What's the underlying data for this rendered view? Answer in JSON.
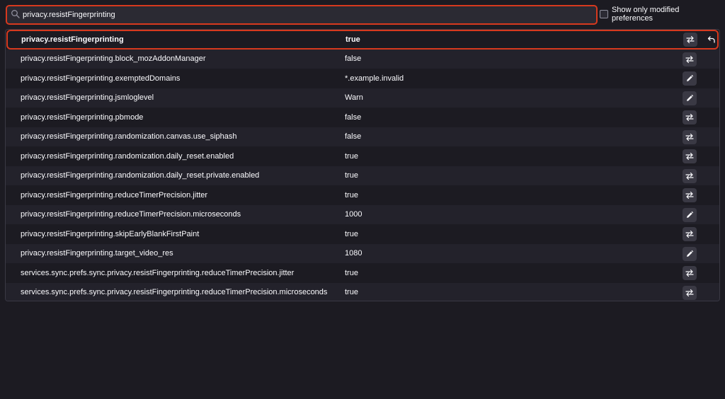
{
  "search": {
    "value": "privacy.resistFingerprinting",
    "placeholder": ""
  },
  "modified_only": {
    "label": "Show only modified preferences",
    "checked": false
  },
  "colors": {
    "background": "#1c1b22",
    "row_alt": "#23222b",
    "highlight": "#d7391e",
    "button": "#3a3944"
  },
  "prefs": [
    {
      "name": "privacy.resistFingerprinting",
      "value": "true",
      "action": "toggle",
      "selected": true,
      "resettable": true
    },
    {
      "name": "privacy.resistFingerprinting.block_mozAddonManager",
      "value": "false",
      "action": "toggle"
    },
    {
      "name": "privacy.resistFingerprinting.exemptedDomains",
      "value": "*.example.invalid",
      "action": "edit"
    },
    {
      "name": "privacy.resistFingerprinting.jsmloglevel",
      "value": "Warn",
      "action": "edit"
    },
    {
      "name": "privacy.resistFingerprinting.pbmode",
      "value": "false",
      "action": "toggle"
    },
    {
      "name": "privacy.resistFingerprinting.randomization.canvas.use_siphash",
      "value": "false",
      "action": "toggle"
    },
    {
      "name": "privacy.resistFingerprinting.randomization.daily_reset.enabled",
      "value": "true",
      "action": "toggle"
    },
    {
      "name": "privacy.resistFingerprinting.randomization.daily_reset.private.enabled",
      "value": "true",
      "action": "toggle"
    },
    {
      "name": "privacy.resistFingerprinting.reduceTimerPrecision.jitter",
      "value": "true",
      "action": "toggle"
    },
    {
      "name": "privacy.resistFingerprinting.reduceTimerPrecision.microseconds",
      "value": "1000",
      "action": "edit"
    },
    {
      "name": "privacy.resistFingerprinting.skipEarlyBlankFirstPaint",
      "value": "true",
      "action": "toggle"
    },
    {
      "name": "privacy.resistFingerprinting.target_video_res",
      "value": "1080",
      "action": "edit"
    },
    {
      "name": "services.sync.prefs.sync.privacy.resistFingerprinting.reduceTimerPrecision.jitter",
      "value": "true",
      "action": "toggle"
    },
    {
      "name": "services.sync.prefs.sync.privacy.resistFingerprinting.reduceTimerPrecision.microseconds",
      "value": "true",
      "action": "toggle"
    }
  ]
}
